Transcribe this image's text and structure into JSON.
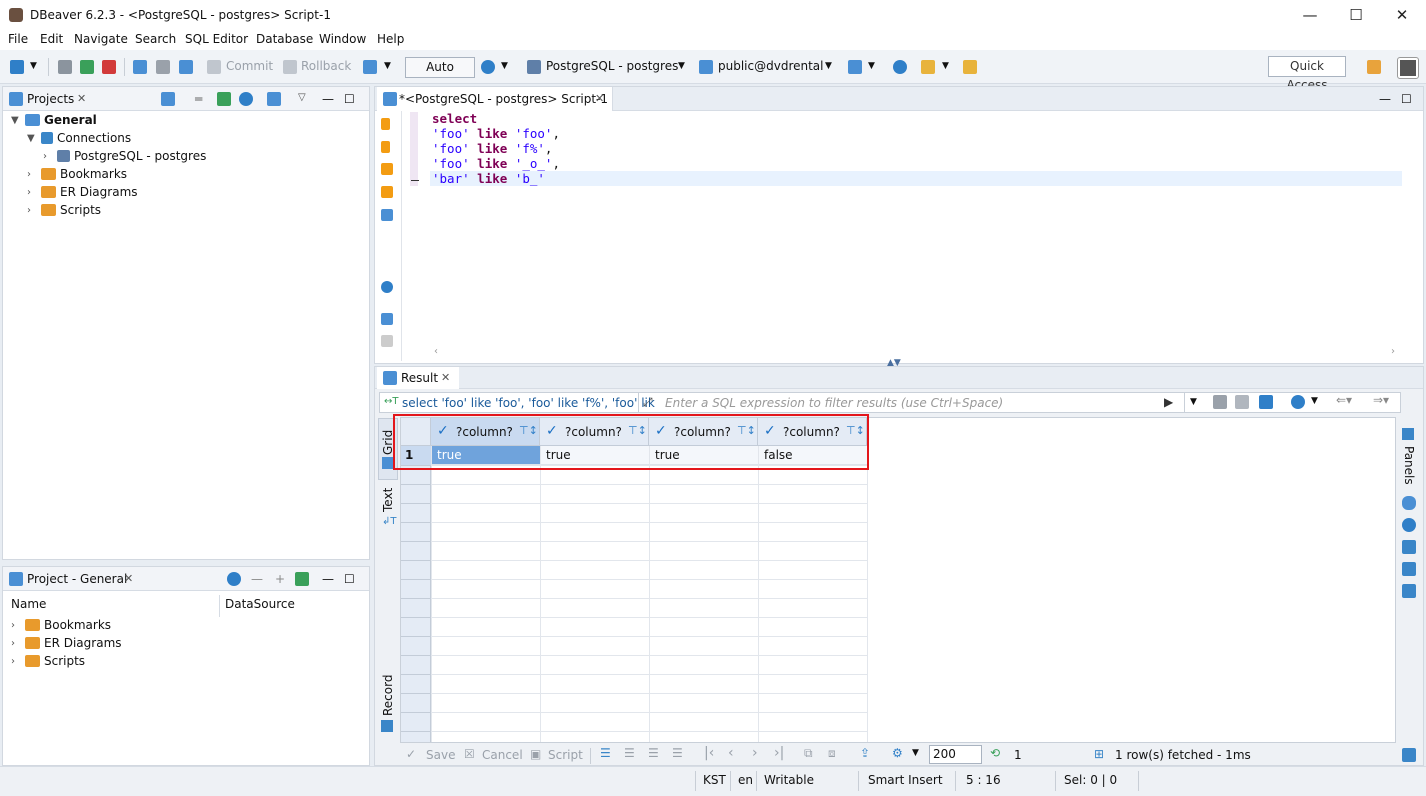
{
  "window": {
    "title": "DBeaver 6.2.3 - <PostgreSQL - postgres> Script-1",
    "controls": [
      "—",
      "☐",
      "✕"
    ]
  },
  "menu": [
    "File",
    "Edit",
    "Navigate",
    "Search",
    "SQL Editor",
    "Database",
    "Window",
    "Help"
  ],
  "toolbar": {
    "commit": "Commit",
    "rollback": "Rollback",
    "auto": "Auto",
    "connection": "PostgreSQL - postgres",
    "schema": "public@dvdrental",
    "quick_access": "Quick Access"
  },
  "projects_panel": {
    "tab": "Projects",
    "tree": {
      "general": "General",
      "connections": "Connections",
      "connection_item": "PostgreSQL - postgres",
      "bookmarks": "Bookmarks",
      "er_diagrams": "ER Diagrams",
      "scripts": "Scripts"
    }
  },
  "project_general_panel": {
    "tab": "Project - General",
    "columns": [
      "Name",
      "DataSource"
    ],
    "items": [
      "Bookmarks",
      "ER Diagrams",
      "Scripts"
    ]
  },
  "editor": {
    "tab": "*<PostgreSQL - postgres> Script-1",
    "lines": {
      "l1": "select",
      "l2a": "'foo'",
      "l2b": "like",
      "l2c": "'foo'",
      "l2d": ",",
      "l3a": "'foo'",
      "l3b": "like",
      "l3c": "'f%'",
      "l3d": ",",
      "l4a": "'foo'",
      "l4b": "like",
      "l4c": "'_o_'",
      "l4d": ",",
      "l5a": "'bar'",
      "l5b": "like",
      "l5c": "'b_'"
    }
  },
  "result": {
    "tab": "Result",
    "query_text": "select 'foo' like 'foo', 'foo' like 'f%', 'foo' lik",
    "filter_placeholder": "Enter a SQL expression to filter results (use Ctrl+Space)",
    "side_tabs": {
      "grid": "Grid",
      "text": "Text",
      "record": "Record",
      "panels": "Panels"
    },
    "columns": [
      "?column?",
      "?column?",
      "?column?",
      "?column?"
    ],
    "rows": [
      {
        "num": "1",
        "values": [
          "true",
          "true",
          "true",
          "false"
        ]
      }
    ],
    "bottom": {
      "save": "Save",
      "cancel": "Cancel",
      "script": "Script",
      "fetch_size": "200",
      "refresh_count": "1",
      "status": "1 row(s) fetched - 1ms"
    }
  },
  "statusbar": {
    "timezone": "KST",
    "locale": "en",
    "mode": "Writable",
    "insert": "Smart Insert",
    "position": "5 : 16",
    "selection": "Sel: 0 | 0"
  }
}
